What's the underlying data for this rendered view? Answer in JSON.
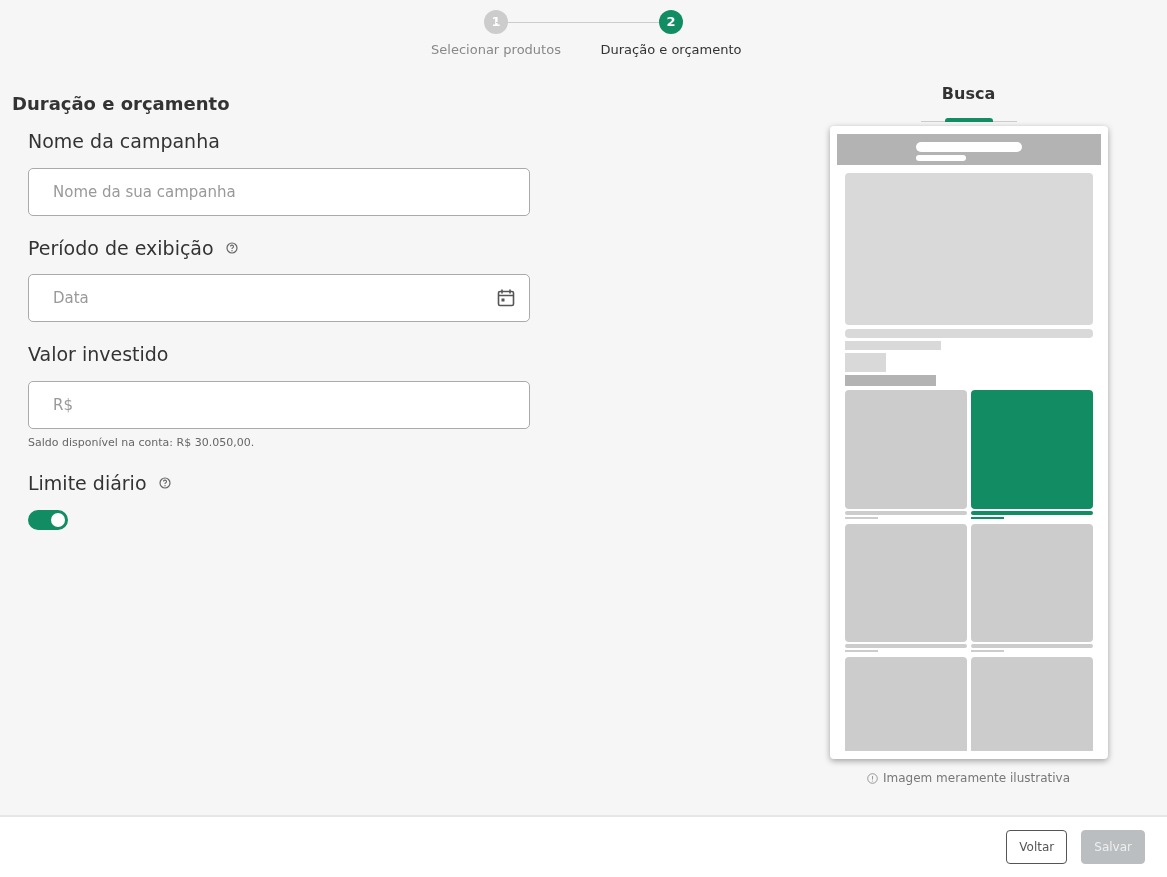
{
  "stepper": [
    {
      "number": "1",
      "label": "Selecionar produtos",
      "selected": false
    },
    {
      "number": "2",
      "label": "Duração e orçamento",
      "selected": true
    }
  ],
  "form": {
    "title": "Duração e orçamento",
    "fields": [
      {
        "kind": "text",
        "label": "Nome da campanha",
        "placeholder": "Nome da sua campanha",
        "help": false
      },
      {
        "kind": "date",
        "label": "Período de exibição",
        "placeholder": "Data",
        "help": true
      },
      {
        "kind": "money",
        "label": "Valor investido",
        "placeholder": "R$",
        "help": false,
        "hint": "Saldo disponível na conta: R$ 30.050,00."
      },
      {
        "kind": "toggle",
        "label": "Limite diário",
        "help": true,
        "on": true
      }
    ]
  },
  "preview": {
    "tabs": [
      {
        "label": "Busca",
        "selected": true
      }
    ],
    "note": "Imagem meramente ilustrativa"
  },
  "footer": {
    "buttons": [
      {
        "label": "Voltar",
        "kind": "outline",
        "disabled": false
      },
      {
        "label": "Salvar",
        "kind": "primary",
        "disabled": true
      }
    ]
  }
}
